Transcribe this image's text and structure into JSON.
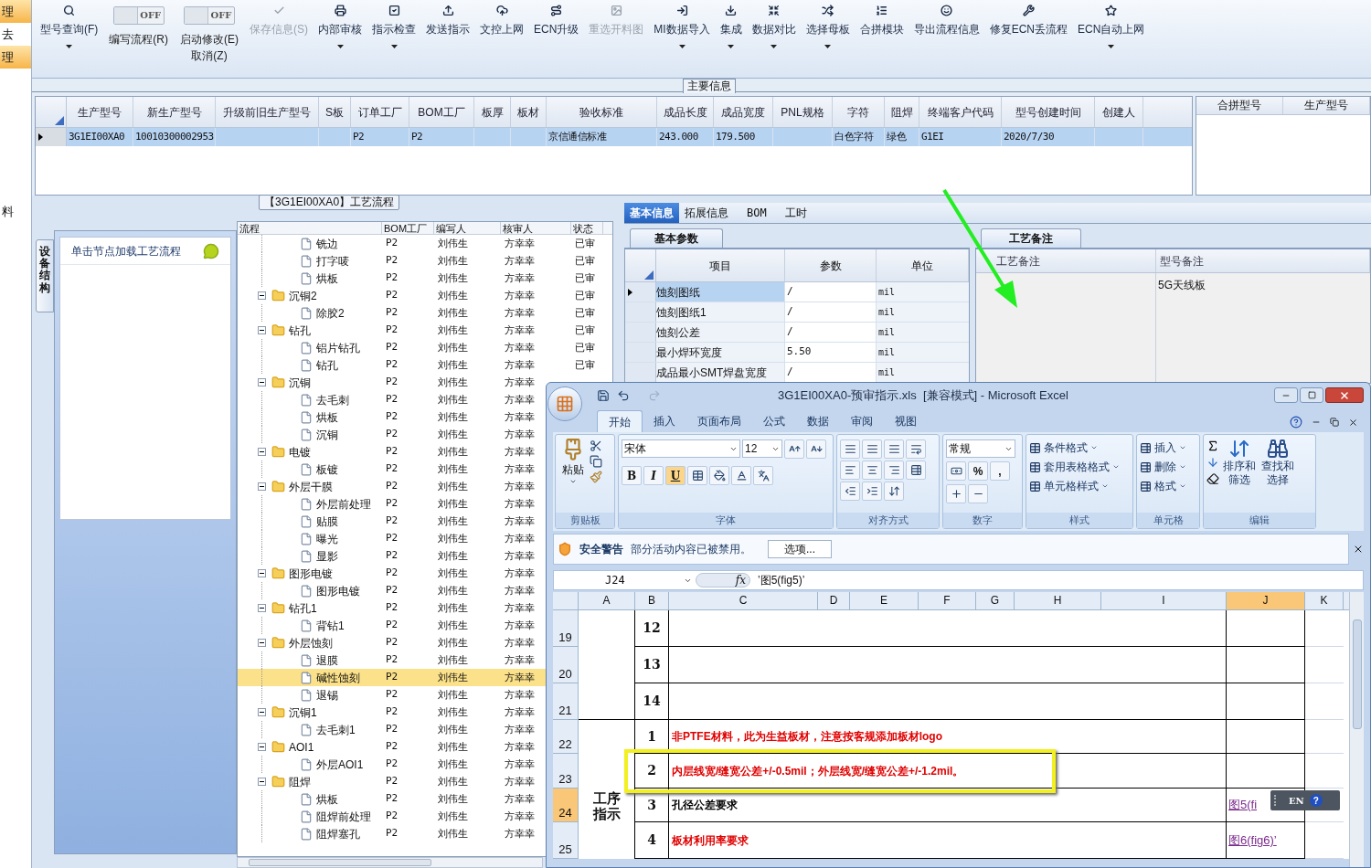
{
  "left_strip": [
    {
      "label": "理",
      "selected": true
    },
    {
      "label": "去",
      "selected": false
    },
    {
      "label": "理",
      "selected": true
    }
  ],
  "left_strip_note": "料",
  "toolbar": [
    {
      "kind": "button",
      "label": "型号查询(F)",
      "disabled": false,
      "dropdown": true
    },
    {
      "kind": "toggle",
      "switch": "OFF",
      "on": false,
      "label": "编写流程(R)"
    },
    {
      "kind": "toggle",
      "switch": "OFF",
      "on": false,
      "label": "启动修改(E)",
      "sublabel": "取消(Z)"
    },
    {
      "kind": "button",
      "label": "保存信息(S)",
      "disabled": true,
      "dropdown": false
    },
    {
      "kind": "button",
      "label": "内部审核",
      "disabled": false,
      "dropdown": true
    },
    {
      "kind": "button",
      "label": "指示检查",
      "disabled": false,
      "dropdown": true
    },
    {
      "kind": "button",
      "label": "发送指示",
      "disabled": false,
      "dropdown": false
    },
    {
      "kind": "button",
      "label": "文控上网",
      "disabled": false,
      "dropdown": false
    },
    {
      "kind": "button",
      "label": "ECN升级",
      "disabled": false,
      "dropdown": false
    },
    {
      "kind": "button",
      "label": "重选开料图",
      "disabled": true,
      "dropdown": false
    },
    {
      "kind": "button",
      "label": "MI数据导入",
      "disabled": false,
      "dropdown": true
    },
    {
      "kind": "button",
      "label": "集成",
      "disabled": false,
      "dropdown": true
    },
    {
      "kind": "button",
      "label": "数据对比",
      "disabled": false,
      "dropdown": true
    },
    {
      "kind": "button",
      "label": "选择母板",
      "disabled": false,
      "dropdown": true
    },
    {
      "kind": "button",
      "label": "合拼模块",
      "disabled": false,
      "dropdown": false
    },
    {
      "kind": "button",
      "label": "导出流程信息",
      "disabled": false,
      "dropdown": false
    },
    {
      "kind": "button",
      "label": "修复ECN丢流程",
      "disabled": false,
      "dropdown": false
    },
    {
      "kind": "button",
      "label": "ECN自动上网",
      "disabled": false,
      "dropdown": true
    }
  ],
  "main_info": {
    "title": "主要信息",
    "columns": [
      "生产型号",
      "新生产型号",
      "升级前旧生产型号",
      "S板",
      "订单工厂",
      "BOM工厂",
      "板厚",
      "板材",
      "验收标准",
      "成品长度",
      "成品宽度",
      "PNL规格",
      "字符",
      "阻焊",
      "终端客户代码",
      "型号创建时间",
      "创建人"
    ],
    "rows": [
      {
        "selected": true,
        "cells": [
          "3G1EI00XA0",
          "10010300002953",
          null,
          null,
          "P2",
          "P2",
          null,
          null,
          "京信通信标准",
          "243.000",
          "179.500",
          null,
          "白色字符",
          "绿色",
          "G1EI",
          "2020/7/30",
          null
        ]
      }
    ],
    "side_columns": [
      "合拼型号",
      "生产型号"
    ]
  },
  "process": {
    "side_tab": "设备结构",
    "hint": "单击节点加载工艺流程",
    "title": "【3G1EI00XA0】工艺流程",
    "columns": [
      "流程",
      "BOM工厂",
      "编写人",
      "核审人",
      "状态"
    ],
    "tree": [
      {
        "kind": "leaf",
        "label": "铣边",
        "bom": "P2",
        "writer": "刘伟生",
        "reviewer": "方幸幸",
        "status": "已审",
        "selected": false
      },
      {
        "kind": "leaf",
        "label": "打字唛",
        "bom": "P2",
        "writer": "刘伟生",
        "reviewer": "方幸幸",
        "status": "已审",
        "selected": false
      },
      {
        "kind": "leaf",
        "label": "烘板",
        "bom": "P2",
        "writer": "刘伟生",
        "reviewer": "方幸幸",
        "status": "已审",
        "selected": false
      },
      {
        "kind": "folder",
        "label": "沉铜2",
        "bom": "P2",
        "writer": "刘伟生",
        "reviewer": "方幸幸",
        "status": "已审",
        "selected": false,
        "expanded": true,
        "children": [
          {
            "kind": "leaf",
            "label": "除胶2",
            "bom": "P2",
            "writer": "刘伟生",
            "reviewer": "方幸幸",
            "status": "已审",
            "selected": false
          }
        ]
      },
      {
        "kind": "folder",
        "label": "钻孔",
        "bom": "P2",
        "writer": "刘伟生",
        "reviewer": "方幸幸",
        "status": "已审",
        "selected": false,
        "expanded": true,
        "children": [
          {
            "kind": "leaf",
            "label": "铝片钻孔",
            "bom": "P2",
            "writer": "刘伟生",
            "reviewer": "方幸幸",
            "status": "已审",
            "selected": false
          },
          {
            "kind": "leaf",
            "label": "钻孔",
            "bom": "P2",
            "writer": "刘伟生",
            "reviewer": "方幸幸",
            "status": "已审",
            "selected": false
          }
        ]
      },
      {
        "kind": "folder",
        "label": "沉铜",
        "bom": "P2",
        "writer": "刘伟生",
        "reviewer": "方幸幸",
        "selected": false,
        "expanded": true,
        "children": [
          {
            "kind": "leaf",
            "label": "去毛刺",
            "bom": "P2",
            "writer": "刘伟生",
            "reviewer": "方幸幸",
            "selected": false
          },
          {
            "kind": "leaf",
            "label": "烘板",
            "bom": "P2",
            "writer": "刘伟生",
            "reviewer": "方幸幸",
            "selected": false
          },
          {
            "kind": "leaf",
            "label": "沉铜",
            "bom": "P2",
            "writer": "刘伟生",
            "reviewer": "方幸幸",
            "selected": false
          }
        ]
      },
      {
        "kind": "folder",
        "label": "电镀",
        "bom": "P2",
        "writer": "刘伟生",
        "reviewer": "方幸幸",
        "selected": false,
        "expanded": true,
        "children": [
          {
            "kind": "leaf",
            "label": "板镀",
            "bom": "P2",
            "writer": "刘伟生",
            "reviewer": "方幸幸",
            "selected": false
          }
        ]
      },
      {
        "kind": "folder",
        "label": "外层干膜",
        "bom": "P2",
        "writer": "刘伟生",
        "reviewer": "方幸幸",
        "selected": false,
        "expanded": true,
        "children": [
          {
            "kind": "leaf",
            "label": "外层前处理",
            "bom": "P2",
            "writer": "刘伟生",
            "reviewer": "方幸幸",
            "selected": false
          },
          {
            "kind": "leaf",
            "label": "贴膜",
            "bom": "P2",
            "writer": "刘伟生",
            "reviewer": "方幸幸",
            "selected": false
          },
          {
            "kind": "leaf",
            "label": "曝光",
            "bom": "P2",
            "writer": "刘伟生",
            "reviewer": "方幸幸",
            "selected": false
          },
          {
            "kind": "leaf",
            "label": "显影",
            "bom": "P2",
            "writer": "刘伟生",
            "reviewer": "方幸幸",
            "selected": false
          }
        ]
      },
      {
        "kind": "folder",
        "label": "图形电镀",
        "bom": "P2",
        "writer": "刘伟生",
        "reviewer": "方幸幸",
        "selected": false,
        "expanded": true,
        "children": [
          {
            "kind": "leaf",
            "label": "图形电镀",
            "bom": "P2",
            "writer": "刘伟生",
            "reviewer": "方幸幸",
            "selected": false
          }
        ]
      },
      {
        "kind": "folder",
        "label": "钻孔1",
        "bom": "P2",
        "writer": "刘伟生",
        "reviewer": "方幸幸",
        "selected": false,
        "expanded": true,
        "children": [
          {
            "kind": "leaf",
            "label": "背钻1",
            "bom": "P2",
            "writer": "刘伟生",
            "reviewer": "方幸幸",
            "selected": false
          }
        ]
      },
      {
        "kind": "folder",
        "label": "外层蚀刻",
        "bom": "P2",
        "writer": "刘伟生",
        "reviewer": "方幸幸",
        "selected": false,
        "expanded": true,
        "children": [
          {
            "kind": "leaf",
            "label": "退膜",
            "bom": "P2",
            "writer": "刘伟生",
            "reviewer": "方幸幸",
            "selected": false
          },
          {
            "kind": "leaf",
            "label": "碱性蚀刻",
            "bom": "P2",
            "writer": "刘伟生",
            "reviewer": "方幸幸",
            "selected": true
          },
          {
            "kind": "leaf",
            "label": "退锡",
            "bom": "P2",
            "writer": "刘伟生",
            "reviewer": "方幸幸",
            "selected": false
          }
        ]
      },
      {
        "kind": "folder",
        "label": "沉铜1",
        "bom": "P2",
        "writer": "刘伟生",
        "reviewer": "方幸幸",
        "selected": false,
        "expanded": true,
        "children": [
          {
            "kind": "leaf",
            "label": "去毛刺1",
            "bom": "P2",
            "writer": "刘伟生",
            "reviewer": "方幸幸",
            "selected": false
          }
        ]
      },
      {
        "kind": "folder",
        "label": "AOI1",
        "bom": "P2",
        "writer": "刘伟生",
        "reviewer": "方幸幸",
        "selected": false,
        "expanded": true,
        "children": [
          {
            "kind": "leaf",
            "label": "外层AOI1",
            "bom": "P2",
            "writer": "刘伟生",
            "reviewer": "方幸幸",
            "selected": false
          }
        ]
      },
      {
        "kind": "folder",
        "label": "阻焊",
        "bom": "P2",
        "writer": "刘伟生",
        "reviewer": "方幸幸",
        "selected": false,
        "expanded": true,
        "children": [
          {
            "kind": "leaf",
            "label": "烘板",
            "bom": "P2",
            "writer": "刘伟生",
            "reviewer": "方幸幸",
            "selected": false
          },
          {
            "kind": "leaf",
            "label": "阻焊前处理",
            "bom": "P2",
            "writer": "刘伟生",
            "reviewer": "方幸幸",
            "selected": false
          },
          {
            "kind": "leaf",
            "label": "阻焊塞孔",
            "bom": "P2",
            "writer": "刘伟生",
            "reviewer": "方幸幸",
            "selected": false
          }
        ]
      }
    ]
  },
  "details": {
    "tabs": [
      {
        "label": "基本信息",
        "selected": true
      },
      {
        "label": "拓展信息",
        "selected": false
      },
      {
        "label": "BOM",
        "selected": false
      },
      {
        "label": "工时",
        "selected": false
      }
    ],
    "params_tab": "基本参数",
    "param_columns": [
      "项目",
      "参数",
      "单位"
    ],
    "params": [
      {
        "item": "蚀刻图纸",
        "value": "/",
        "unit": "mil",
        "selected": true
      },
      {
        "item": "蚀刻图纸1",
        "value": "/",
        "unit": "mil",
        "selected": false
      },
      {
        "item": "蚀刻公差",
        "value": "/",
        "unit": "mil",
        "selected": false
      },
      {
        "item": "最小焊环宽度",
        "value": "5.50",
        "unit": "mil",
        "selected": false
      },
      {
        "item": "成品最小SMT焊盘宽度",
        "value": "/",
        "unit": "mil",
        "selected": false
      }
    ],
    "notes_tab": "工艺备注",
    "notes_columns": [
      "工艺备注",
      "型号备注"
    ],
    "model_note": "5G天线板"
  },
  "excel": {
    "title": "3G1EI00XA0-预审指示.xls  [兼容模式] - Microsoft Excel",
    "tabs": [
      {
        "label": "开始",
        "selected": true
      },
      {
        "label": "插入",
        "selected": false
      },
      {
        "label": "页面布局",
        "selected": false
      },
      {
        "label": "公式",
        "selected": false
      },
      {
        "label": "数据",
        "selected": false
      },
      {
        "label": "审阅",
        "selected": false
      },
      {
        "label": "视图",
        "selected": false
      }
    ],
    "paste": "粘贴",
    "font_name": "宋体",
    "font_size": "12",
    "format_keys": [
      "B",
      "I",
      "U"
    ],
    "number_format": "常规",
    "number_keys": [
      "%",
      ","
    ],
    "style_buttons": [
      "条件格式",
      "套用表格格式",
      "单元格样式"
    ],
    "cell_buttons": [
      "插入",
      "删除",
      "格式"
    ],
    "edit_buttons": [
      "排序和筛选",
      "查找和选择"
    ],
    "groups": [
      "剪贴板",
      "字体",
      "对齐方式",
      "数字",
      "样式",
      "单元格",
      "编辑"
    ],
    "security": {
      "title": "安全警告",
      "message": "部分活动内容已被禁用。",
      "button": "选项..."
    },
    "formula": {
      "cell": "J24",
      "fx": "fx",
      "value": "’图5(fig5)’"
    },
    "columns": [
      {
        "label": "A",
        "selected": false
      },
      {
        "label": "B",
        "selected": false
      },
      {
        "label": "C",
        "selected": false
      },
      {
        "label": "D",
        "selected": false
      },
      {
        "label": "E",
        "selected": false
      },
      {
        "label": "F",
        "selected": false
      },
      {
        "label": "G",
        "selected": false
      },
      {
        "label": "H",
        "selected": false
      },
      {
        "label": "I",
        "selected": false
      },
      {
        "label": "J",
        "selected": true
      },
      {
        "label": "K",
        "selected": false
      }
    ],
    "rows": [
      {
        "number": "19",
        "selected": false,
        "b": "12",
        "highlighted": false
      },
      {
        "number": "20",
        "selected": false,
        "b": "13",
        "highlighted": false
      },
      {
        "number": "21",
        "selected": false,
        "b": "14",
        "highlighted": false
      },
      {
        "number": "22",
        "selected": false,
        "b": "1",
        "c": "非PTFE材料，此为生益板材，注意按客规添加板材logo",
        "emphasis": true,
        "highlighted": false
      },
      {
        "number": "23",
        "selected": false,
        "b": "2",
        "c": "内层线宽/缝宽公差+/-0.5mil；外层线宽/缝宽公差+/-1.2mil。",
        "emphasis": true,
        "highlighted": true
      },
      {
        "number": "24",
        "selected": true,
        "a": "工序指示",
        "b": "3",
        "c": "孔径公差要求",
        "emphasis": false,
        "j": "图5(fi",
        "highlighted": false
      },
      {
        "number": "25",
        "selected": false,
        "b": "4",
        "c": "板材利用率要求",
        "emphasis": true,
        "j": "图6(fig6)’",
        "highlighted": false
      }
    ],
    "ime": {
      "lang": "EN",
      "help": "?"
    }
  }
}
